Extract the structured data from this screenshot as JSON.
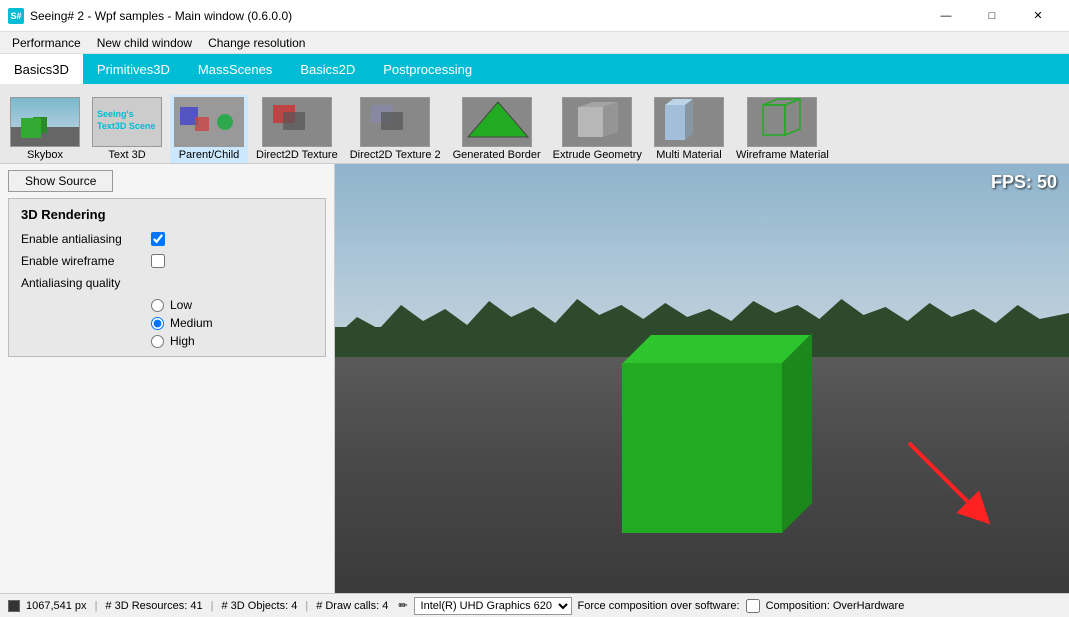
{
  "titleBar": {
    "title": "Seeing# 2 - Wpf samples - Main window (0.6.0.0)",
    "minBtn": "—",
    "maxBtn": "□",
    "closeBtn": "✕"
  },
  "menuBar": {
    "items": [
      {
        "id": "performance",
        "label": "Performance"
      },
      {
        "id": "new-child-window",
        "label": "New child window"
      },
      {
        "id": "change-resolution",
        "label": "Change resolution"
      }
    ]
  },
  "tabs": [
    {
      "id": "basics3d",
      "label": "Basics3D",
      "active": true
    },
    {
      "id": "primitives3d",
      "label": "Primitives3D",
      "active": false
    },
    {
      "id": "massscenes",
      "label": "MassScenes",
      "active": false
    },
    {
      "id": "basics2d",
      "label": "Basics2D",
      "active": false
    },
    {
      "id": "postprocessing",
      "label": "Postprocessing",
      "active": false
    }
  ],
  "samples": [
    {
      "id": "skybox",
      "label": "Skybox",
      "active": false
    },
    {
      "id": "text3d",
      "label": "Text 3D",
      "active": false
    },
    {
      "id": "parentchild",
      "label": "Parent/Child",
      "active": true
    },
    {
      "id": "direct2dtexture",
      "label": "Direct2D Texture",
      "active": false
    },
    {
      "id": "direct2dtexture2",
      "label": "Direct2D Texture 2",
      "active": false
    },
    {
      "id": "generatedborder",
      "label": "Generated Border",
      "active": false
    },
    {
      "id": "extrudegeometry",
      "label": "Extrude Geometry",
      "active": false
    },
    {
      "id": "multimaterial",
      "label": "Multi Material",
      "active": false
    },
    {
      "id": "wireframematerial",
      "label": "Wireframe Material",
      "active": false
    }
  ],
  "showSourceBtn": "Show Source",
  "settingsPanel": {
    "title": "3D Rendering",
    "antialiasing": {
      "label": "Enable antialiasing",
      "checked": true
    },
    "wireframe": {
      "label": "Enable wireframe",
      "checked": false
    },
    "quality": {
      "label": "Antialiasing quality",
      "options": [
        {
          "value": "low",
          "label": "Low",
          "selected": false
        },
        {
          "value": "medium",
          "label": "Medium",
          "selected": true
        },
        {
          "value": "high",
          "label": "High",
          "selected": false
        }
      ]
    }
  },
  "viewport": {
    "fps": "FPS: 50"
  },
  "statusBar": {
    "resolution": "1067,541 px",
    "resources": "# 3D Resources: 41",
    "objects": "# 3D Objects: 4",
    "drawCalls": "# Draw calls: 4",
    "gpu": "Intel(R) UHD Graphics 620",
    "forceComposition": "Force composition over software:",
    "composition": "Composition: OverHardware"
  }
}
